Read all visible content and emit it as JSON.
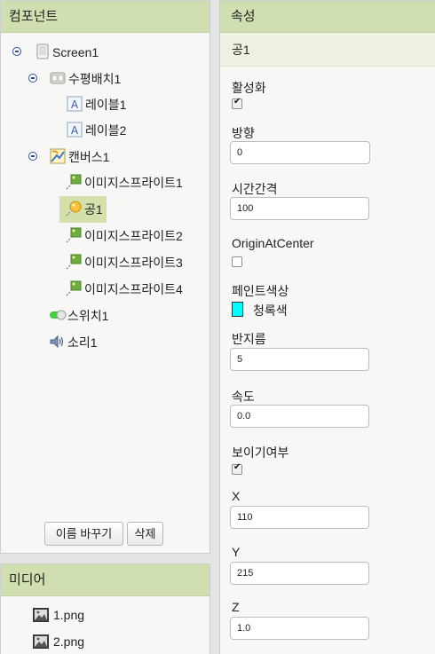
{
  "components": {
    "header": "컴포넌트",
    "tree": {
      "screen": "Screen1",
      "arrangement": "수평배치1",
      "label1": "레이블1",
      "label2": "레이블2",
      "canvas": "캔버스1",
      "sprite1": "이미지스프라이트1",
      "ball": "공1",
      "sprite2": "이미지스프라이트2",
      "sprite3": "이미지스프라이트3",
      "sprite4": "이미지스프라이트4",
      "switch": "스위치1",
      "sound": "소리1"
    },
    "rename_button": "이름 바꾸기",
    "delete_button": "삭제"
  },
  "media": {
    "header": "미디어",
    "items": [
      "1.png",
      "2.png"
    ]
  },
  "properties": {
    "header": "속성",
    "component": "공1",
    "enabled_label": "활성화",
    "enabled": true,
    "heading_label": "방향",
    "heading_value": "0",
    "interval_label": "시간간격",
    "interval_value": "100",
    "origin_label": "OriginAtCenter",
    "origin": false,
    "paint_label": "페인트색상",
    "paint_value": "청록색",
    "paint_color": "#00ffff",
    "radius_label": "반지름",
    "radius_value": "5",
    "speed_label": "속도",
    "speed_value": "0.0",
    "visible_label": "보이기여부",
    "visible": true,
    "x_label": "X",
    "x_value": "110",
    "y_label": "Y",
    "y_value": "215",
    "z_label": "Z",
    "z_value": "1.0"
  }
}
